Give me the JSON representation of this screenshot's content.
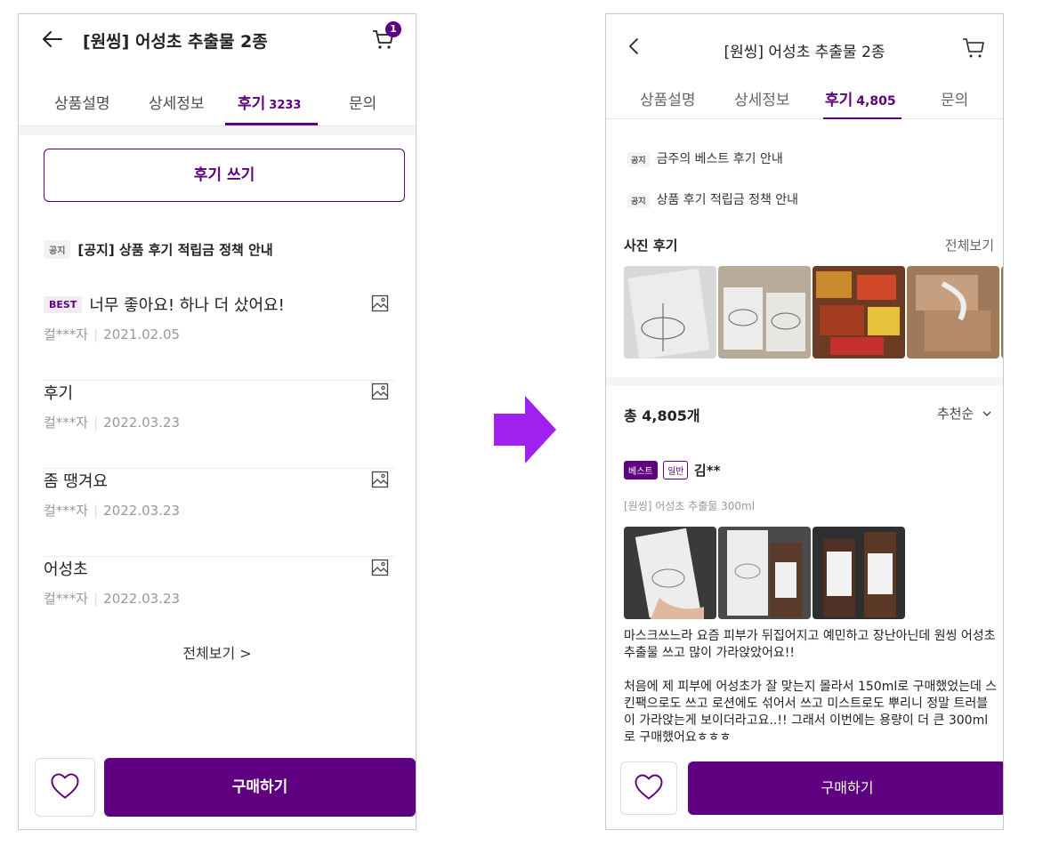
{
  "colors": {
    "brand": "#5f0080",
    "arrow": "#a020f0"
  },
  "left": {
    "header": {
      "title": "[원씽] 어성초 추출물 2종",
      "cart_count": "1"
    },
    "tabs": [
      {
        "label": "상품설명"
      },
      {
        "label": "상세정보"
      },
      {
        "label": "후기",
        "count": "3233"
      },
      {
        "label": "문의"
      }
    ],
    "write_review": "후기 쓰기",
    "notice": {
      "tag": "공지",
      "text": "[공지] 상품 후기 적립금 정책 안내"
    },
    "reviews": [
      {
        "badge": "BEST",
        "title": "너무 좋아요! 하나 더 샀어요!",
        "author": "컬***자",
        "date": "2021.02.05"
      },
      {
        "title": "후기",
        "author": "컬***자",
        "date": "2022.03.23"
      },
      {
        "title": "좀 땡겨요",
        "author": "컬***자",
        "date": "2022.03.23"
      },
      {
        "title": "어성초",
        "author": "컬***자",
        "date": "2022.03.23"
      }
    ],
    "view_all": "전체보기 >",
    "buy": "구매하기"
  },
  "right": {
    "header": {
      "title": "[원씽] 어성초 추출물 2종"
    },
    "tabs": [
      {
        "label": "상품설명"
      },
      {
        "label": "상세정보"
      },
      {
        "label": "후기",
        "count": "4,805"
      },
      {
        "label": "문의"
      }
    ],
    "notices": [
      {
        "tag": "공지",
        "text": "금주의 베스트 후기 안내"
      },
      {
        "tag": "공지",
        "text": "상품 후기 적립금 정책 안내"
      }
    ],
    "photo_reviews": {
      "title": "사진 후기",
      "view_all": "전체보기"
    },
    "total": "총 4,805개",
    "sort": "추천순",
    "review": {
      "badge_best": "베스트",
      "badge_normal": "일반",
      "author": "김**",
      "product": "[원씽] 어성초 추출물 300ml",
      "paragraph1": "마스크쓰느라 요즘 피부가 뒤집어지고 예민하고 장난아닌데 원씽 어성초 추출물 쓰고 많이 가라앉았어요!!",
      "paragraph2": "처음에 제 피부에 어성초가 잘 맞는지 몰라서 150ml로 구매했었는데 스킨팩으로도 쓰고 로션에도 섞어서 쓰고 미스트로도 뿌리니 정말 트러블이 가라앉는게 보이더라고요..!! 그래서 이번에는 용량이 더 큰 300ml로 구매했어요ㅎㅎㅎ"
    },
    "buy": "구매하기"
  }
}
